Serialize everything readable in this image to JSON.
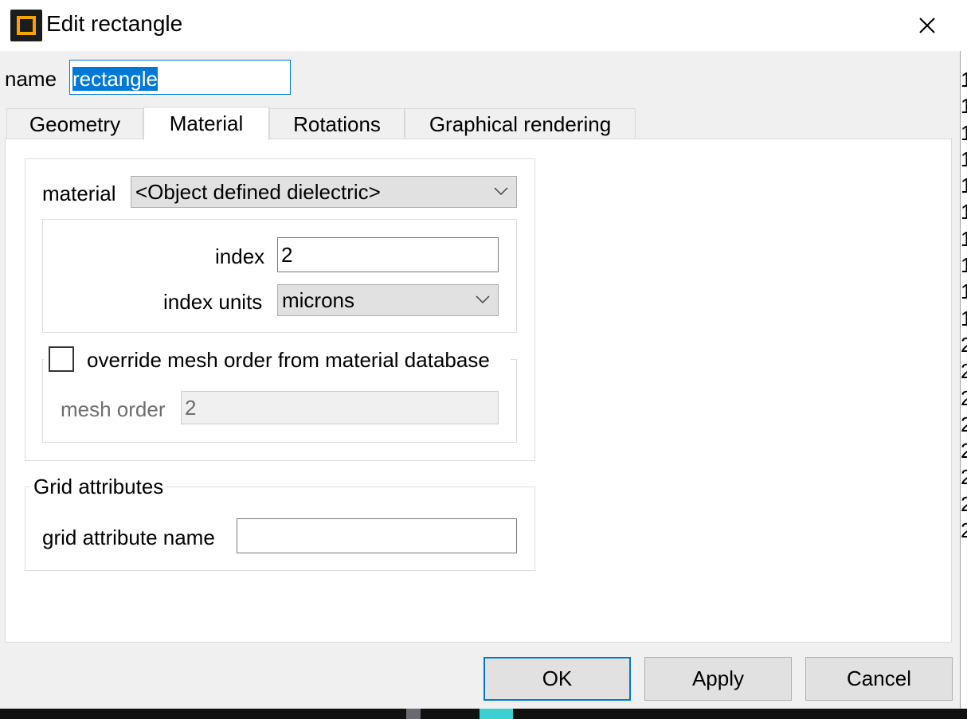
{
  "window": {
    "title": "Edit rectangle",
    "close_icon": "close-icon",
    "app_icon": "rectangle-app-icon"
  },
  "name_field": {
    "label": "name",
    "value": "rectangle"
  },
  "tabs": [
    {
      "label": "Geometry",
      "active": false
    },
    {
      "label": "Material",
      "active": true
    },
    {
      "label": "Rotations",
      "active": false
    },
    {
      "label": "Graphical rendering",
      "active": false
    }
  ],
  "material": {
    "label": "material",
    "selected": "<Object defined dielectric>",
    "index_label": "index",
    "index_value": "2",
    "index_units_label": "index units",
    "index_units_value": "microns",
    "override_label": "override mesh order from material database",
    "override_checked": false,
    "mesh_order_label": "mesh order",
    "mesh_order_value": "2"
  },
  "grid": {
    "group_title": "Grid attributes",
    "name_label": "grid attribute name",
    "name_value": ""
  },
  "buttons": {
    "ok": "OK",
    "apply": "Apply",
    "cancel": "Cancel"
  },
  "background_strip": [
    "1",
    "1",
    "1",
    "1",
    "1",
    "1",
    "1",
    "1",
    "1",
    "1",
    "2",
    "2",
    "2",
    "2",
    "2",
    "2",
    "2",
    "2"
  ],
  "colors": {
    "accent": "#0078d7",
    "icon_orange": "#f5a500"
  }
}
